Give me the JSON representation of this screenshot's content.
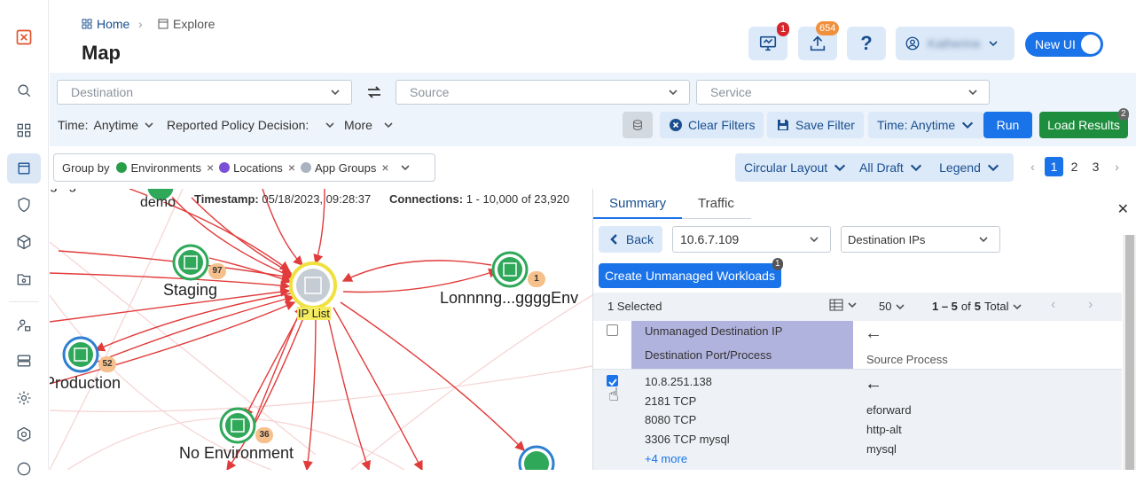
{
  "header": {
    "breadcrumb_home": "Home",
    "breadcrumb_explore": "Explore",
    "title": "Map",
    "notif_count": "1",
    "upload_count": "654",
    "user_name": "Katherine",
    "newui_label": "New UI"
  },
  "filters": {
    "destination_placeholder": "Destination",
    "source_placeholder": "Source",
    "service_placeholder": "Service",
    "time_label": "Time:",
    "time_value": "Anytime",
    "policy_label": "Reported Policy Decision:",
    "more_label": "More",
    "clear_filters": "Clear Filters",
    "save_filter": "Save Filter",
    "time_btn": "Time: Anytime",
    "run": "Run",
    "load_results": "Load Results",
    "load_results_count": "2"
  },
  "groupby": {
    "label": "Group by",
    "chips": [
      "Environments",
      "Locations",
      "App Groups"
    ],
    "chip_colors": [
      "#2a9d4a",
      "#7b4fd6",
      "#aab4c0"
    ]
  },
  "toolbar": {
    "layout": "Circular Layout",
    "draft": "All Draft",
    "legend": "Legend",
    "pages": [
      "1",
      "2",
      "3"
    ]
  },
  "map": {
    "timestamp_label": "Timestamp:",
    "timestamp_value": "05/18/2023, 09:28:37",
    "connections_label": "Connections:",
    "connections_value": "1 - 10,000 of 23,920",
    "partial_label": "ging",
    "nodes": [
      {
        "label": "demo",
        "count": ""
      },
      {
        "label": "Staging",
        "count": "97"
      },
      {
        "label": "IP List",
        "count": ""
      },
      {
        "label": "Lonnnng...ggggEnv",
        "count": "1"
      },
      {
        "label": "Production",
        "count": "52"
      },
      {
        "label": "No Environment",
        "count": "36"
      }
    ]
  },
  "panel": {
    "tab_summary": "Summary",
    "tab_traffic": "Traffic",
    "back": "Back",
    "ip_value": "10.6.7.109",
    "ip_type": "Destination IPs",
    "create_btn": "Create Unmanaged Workloads",
    "create_count": "1",
    "selected": "1 Selected",
    "per_page": "50",
    "range": "1 – 5",
    "of": "of",
    "total_count": "5",
    "total_label": "Total",
    "col_dest_ip": "Unmanaged Destination IP",
    "col_dest_port": "Destination Port/Process",
    "col_source_process": "Source Process",
    "row": {
      "ip": "10.8.251.138",
      "ports": [
        "2181 TCP",
        "8080 TCP",
        "3306 TCP mysql"
      ],
      "more": "+4 more",
      "processes": [
        "eforward",
        "http-alt",
        "mysql"
      ]
    }
  }
}
